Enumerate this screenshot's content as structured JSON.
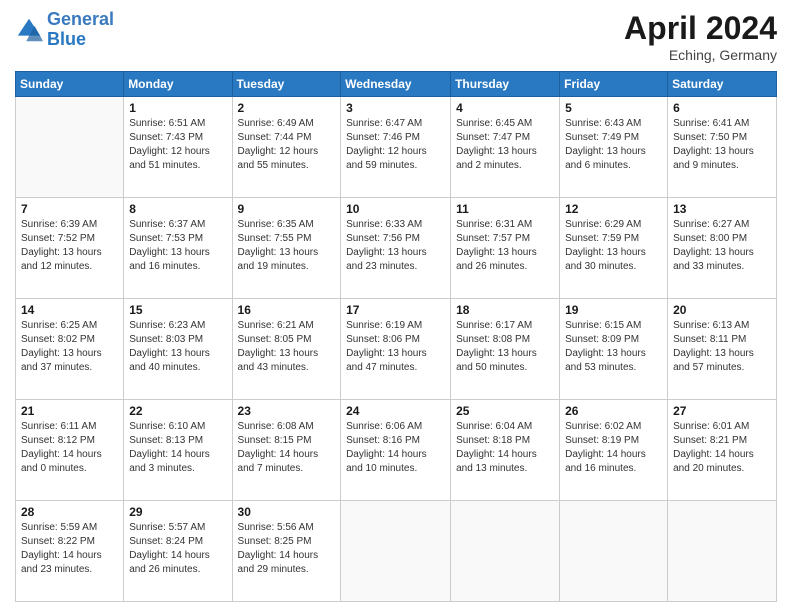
{
  "header": {
    "logo_line1": "General",
    "logo_line2": "Blue",
    "month_title": "April 2024",
    "location": "Eching, Germany"
  },
  "weekdays": [
    "Sunday",
    "Monday",
    "Tuesday",
    "Wednesday",
    "Thursday",
    "Friday",
    "Saturday"
  ],
  "weeks": [
    [
      {
        "day": "",
        "info": ""
      },
      {
        "day": "1",
        "info": "Sunrise: 6:51 AM\nSunset: 7:43 PM\nDaylight: 12 hours\nand 51 minutes."
      },
      {
        "day": "2",
        "info": "Sunrise: 6:49 AM\nSunset: 7:44 PM\nDaylight: 12 hours\nand 55 minutes."
      },
      {
        "day": "3",
        "info": "Sunrise: 6:47 AM\nSunset: 7:46 PM\nDaylight: 12 hours\nand 59 minutes."
      },
      {
        "day": "4",
        "info": "Sunrise: 6:45 AM\nSunset: 7:47 PM\nDaylight: 13 hours\nand 2 minutes."
      },
      {
        "day": "5",
        "info": "Sunrise: 6:43 AM\nSunset: 7:49 PM\nDaylight: 13 hours\nand 6 minutes."
      },
      {
        "day": "6",
        "info": "Sunrise: 6:41 AM\nSunset: 7:50 PM\nDaylight: 13 hours\nand 9 minutes."
      }
    ],
    [
      {
        "day": "7",
        "info": "Sunrise: 6:39 AM\nSunset: 7:52 PM\nDaylight: 13 hours\nand 12 minutes."
      },
      {
        "day": "8",
        "info": "Sunrise: 6:37 AM\nSunset: 7:53 PM\nDaylight: 13 hours\nand 16 minutes."
      },
      {
        "day": "9",
        "info": "Sunrise: 6:35 AM\nSunset: 7:55 PM\nDaylight: 13 hours\nand 19 minutes."
      },
      {
        "day": "10",
        "info": "Sunrise: 6:33 AM\nSunset: 7:56 PM\nDaylight: 13 hours\nand 23 minutes."
      },
      {
        "day": "11",
        "info": "Sunrise: 6:31 AM\nSunset: 7:57 PM\nDaylight: 13 hours\nand 26 minutes."
      },
      {
        "day": "12",
        "info": "Sunrise: 6:29 AM\nSunset: 7:59 PM\nDaylight: 13 hours\nand 30 minutes."
      },
      {
        "day": "13",
        "info": "Sunrise: 6:27 AM\nSunset: 8:00 PM\nDaylight: 13 hours\nand 33 minutes."
      }
    ],
    [
      {
        "day": "14",
        "info": "Sunrise: 6:25 AM\nSunset: 8:02 PM\nDaylight: 13 hours\nand 37 minutes."
      },
      {
        "day": "15",
        "info": "Sunrise: 6:23 AM\nSunset: 8:03 PM\nDaylight: 13 hours\nand 40 minutes."
      },
      {
        "day": "16",
        "info": "Sunrise: 6:21 AM\nSunset: 8:05 PM\nDaylight: 13 hours\nand 43 minutes."
      },
      {
        "day": "17",
        "info": "Sunrise: 6:19 AM\nSunset: 8:06 PM\nDaylight: 13 hours\nand 47 minutes."
      },
      {
        "day": "18",
        "info": "Sunrise: 6:17 AM\nSunset: 8:08 PM\nDaylight: 13 hours\nand 50 minutes."
      },
      {
        "day": "19",
        "info": "Sunrise: 6:15 AM\nSunset: 8:09 PM\nDaylight: 13 hours\nand 53 minutes."
      },
      {
        "day": "20",
        "info": "Sunrise: 6:13 AM\nSunset: 8:11 PM\nDaylight: 13 hours\nand 57 minutes."
      }
    ],
    [
      {
        "day": "21",
        "info": "Sunrise: 6:11 AM\nSunset: 8:12 PM\nDaylight: 14 hours\nand 0 minutes."
      },
      {
        "day": "22",
        "info": "Sunrise: 6:10 AM\nSunset: 8:13 PM\nDaylight: 14 hours\nand 3 minutes."
      },
      {
        "day": "23",
        "info": "Sunrise: 6:08 AM\nSunset: 8:15 PM\nDaylight: 14 hours\nand 7 minutes."
      },
      {
        "day": "24",
        "info": "Sunrise: 6:06 AM\nSunset: 8:16 PM\nDaylight: 14 hours\nand 10 minutes."
      },
      {
        "day": "25",
        "info": "Sunrise: 6:04 AM\nSunset: 8:18 PM\nDaylight: 14 hours\nand 13 minutes."
      },
      {
        "day": "26",
        "info": "Sunrise: 6:02 AM\nSunset: 8:19 PM\nDaylight: 14 hours\nand 16 minutes."
      },
      {
        "day": "27",
        "info": "Sunrise: 6:01 AM\nSunset: 8:21 PM\nDaylight: 14 hours\nand 20 minutes."
      }
    ],
    [
      {
        "day": "28",
        "info": "Sunrise: 5:59 AM\nSunset: 8:22 PM\nDaylight: 14 hours\nand 23 minutes."
      },
      {
        "day": "29",
        "info": "Sunrise: 5:57 AM\nSunset: 8:24 PM\nDaylight: 14 hours\nand 26 minutes."
      },
      {
        "day": "30",
        "info": "Sunrise: 5:56 AM\nSunset: 8:25 PM\nDaylight: 14 hours\nand 29 minutes."
      },
      {
        "day": "",
        "info": ""
      },
      {
        "day": "",
        "info": ""
      },
      {
        "day": "",
        "info": ""
      },
      {
        "day": "",
        "info": ""
      }
    ]
  ]
}
